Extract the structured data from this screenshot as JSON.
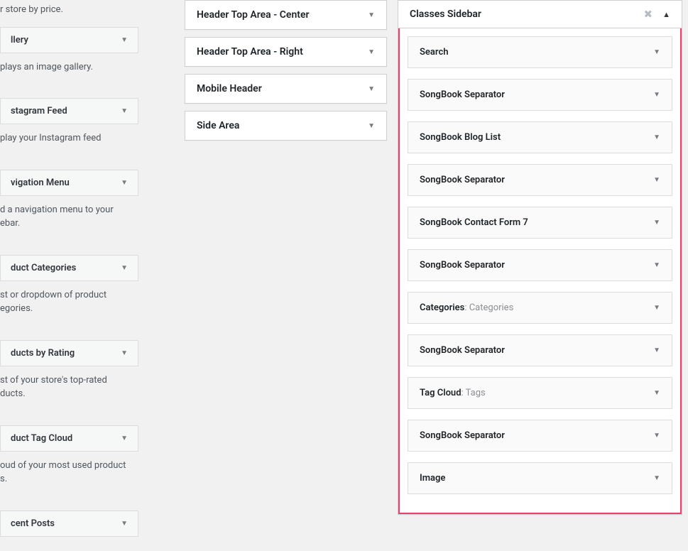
{
  "left_column": {
    "price_filter_desc": "r store by price.",
    "gallery": {
      "title": "llery",
      "desc": "plays an image gallery."
    },
    "instagram": {
      "title": "stagram Feed",
      "desc": "play your Instagram feed"
    },
    "nav_menu": {
      "title": "vigation Menu",
      "desc": "d a navigation menu to your ebar."
    },
    "product_categories": {
      "title": "duct Categories",
      "desc": "st or dropdown of product egories."
    },
    "products_rating": {
      "title": "ducts by Rating",
      "desc": "st of your store's top-rated ducts."
    },
    "product_tag": {
      "title": "duct Tag Cloud",
      "desc": "oud of your most used product s."
    },
    "recent_posts": {
      "title": "cent Posts"
    }
  },
  "mid_column": {
    "sections": [
      "Header Top Area - Center",
      "Header Top Area - Right",
      "Mobile Header",
      "Side Area"
    ]
  },
  "right_column": {
    "title": "Classes Sidebar",
    "widgets": [
      {
        "title": "Search",
        "suffix": ""
      },
      {
        "title": "SongBook Separator",
        "suffix": ""
      },
      {
        "title": "SongBook Blog List",
        "suffix": ""
      },
      {
        "title": "SongBook Separator",
        "suffix": ""
      },
      {
        "title": "SongBook Contact Form 7",
        "suffix": ""
      },
      {
        "title": "SongBook Separator",
        "suffix": ""
      },
      {
        "title": "Categories",
        "suffix": ": Categories"
      },
      {
        "title": "SongBook Separator",
        "suffix": ""
      },
      {
        "title": "Tag Cloud",
        "suffix": ": Tags"
      },
      {
        "title": "SongBook Separator",
        "suffix": ""
      },
      {
        "title": "Image",
        "suffix": ""
      }
    ]
  }
}
